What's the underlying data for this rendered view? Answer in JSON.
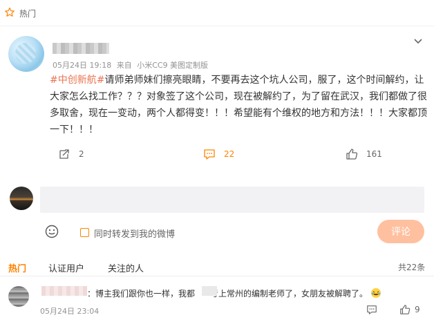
{
  "header": {
    "title": "热门",
    "star_icon": "star-outline-icon"
  },
  "post": {
    "meta": {
      "date": "05月24日 19:18",
      "source_prefix": "来自",
      "source": "小米CC9 美图定制版"
    },
    "tag": "#中创新航#",
    "body": "请师弟师妹们擦亮眼睛，不要再去这个坑人公司，服了，这个时间解约，让大家怎么找工作？？？对象签了这个公司，现在被解约了，为了留在武汉，我们都做了很多取舍，现在一变动，两个人都得变！！！希望能有个维权的地方和方法！！！大家都顶一下！！！",
    "actions": {
      "repost_count": "2",
      "comment_count": "22",
      "like_count": "161"
    }
  },
  "composer": {
    "repost_label": "同时转发到我的微博",
    "submit_label": "评论"
  },
  "tabs": {
    "items": [
      {
        "label": "热门"
      },
      {
        "label": "认证用户"
      },
      {
        "label": "关注的人"
      }
    ],
    "total": "共22条"
  },
  "comment": {
    "text_part1": "：博主我们跟你也一样，我都",
    "text_part2": "考上常州的编制老师了，女朋友被解聘了。",
    "time": "05月24日 23:04",
    "like_count": "9"
  },
  "colors": {
    "accent": "#ff8200",
    "tag": "#eb7350",
    "button_disabled": "#ffc09f"
  }
}
